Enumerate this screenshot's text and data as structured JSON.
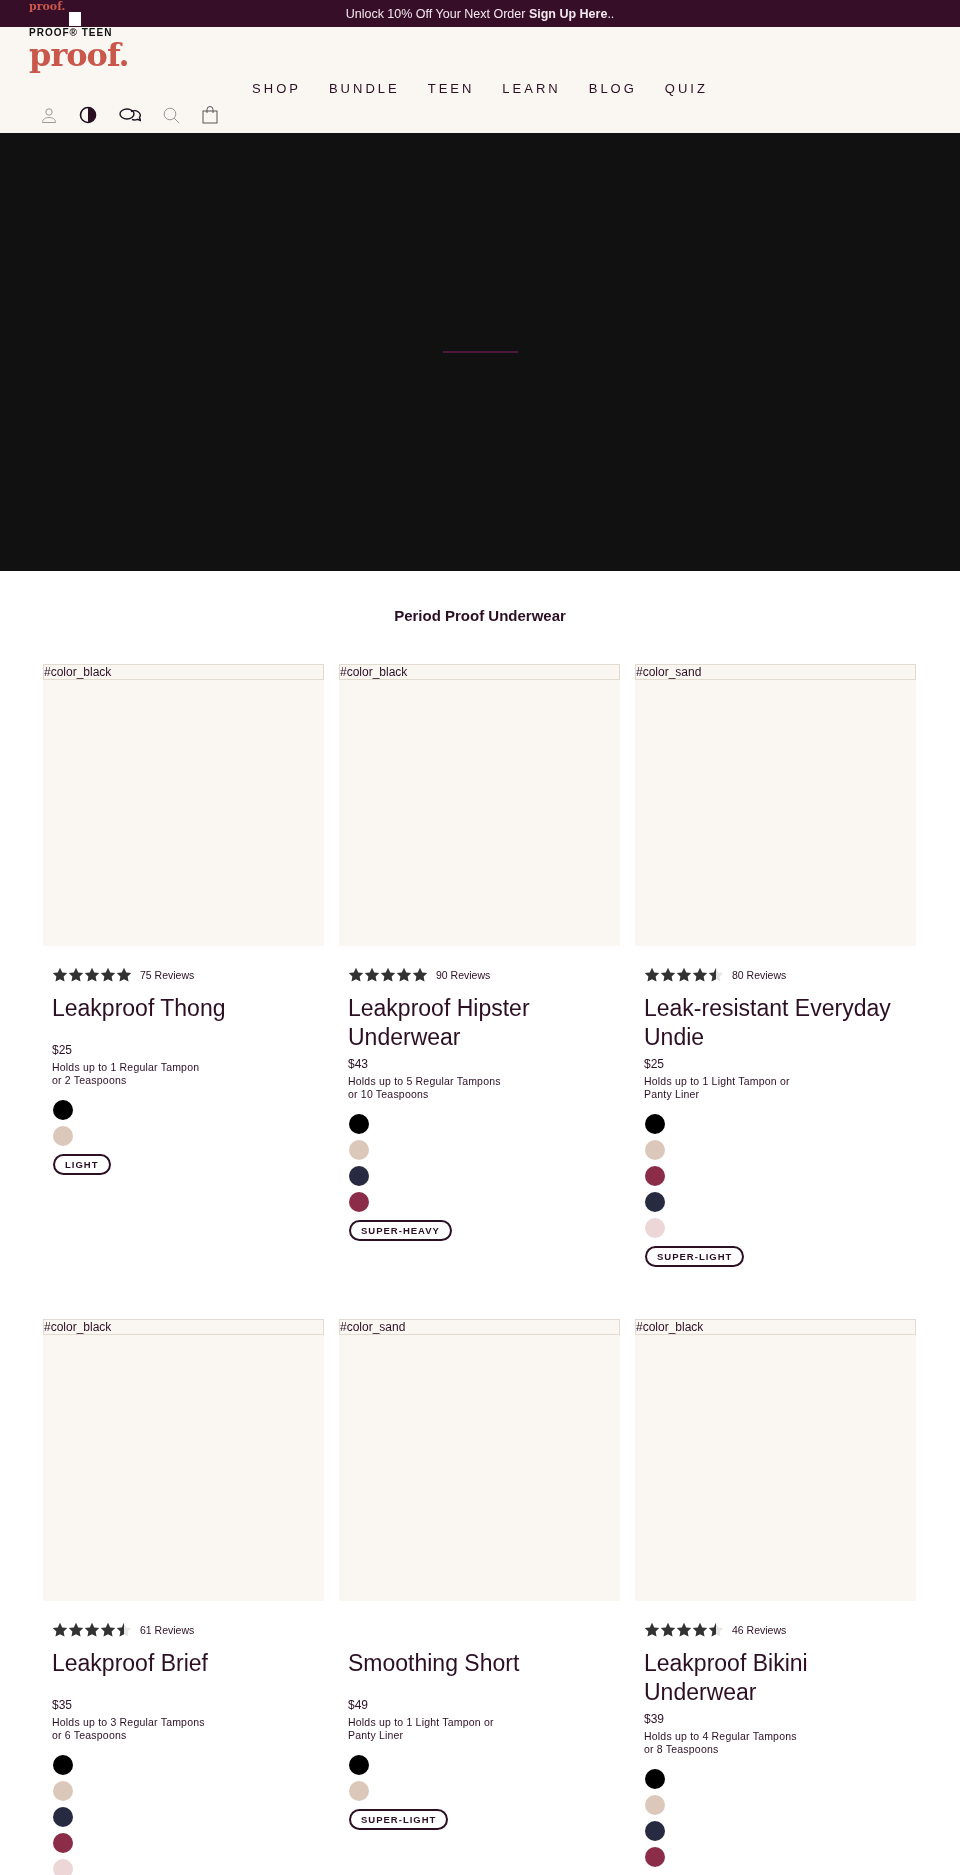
{
  "announcement": {
    "text": "Unlock 10% Off Your Next Order **Sign Up Here**.."
  },
  "logo": {
    "small": "proof.",
    "line": "PROOF® TEEN",
    "big": "proof."
  },
  "nav": [
    "SHOP",
    "BUNDLE",
    "TEEN",
    "LEARN",
    "BLOG",
    "QUIZ"
  ],
  "section_title": "Period Proof Underwear",
  "products": [
    {
      "image_alt": "#color_black",
      "stars": 5,
      "reviews": "75 Reviews",
      "name": "Leakproof Thong",
      "price": "$25",
      "description": "Holds up to 1 Regular Tampon\nor 2 Teaspoons",
      "swatches": [
        {
          "color": "#000000"
        },
        {
          "color": "#dcc8ba"
        }
      ],
      "badge": "LIGHT"
    },
    {
      "image_alt": "#color_black",
      "stars": 5,
      "reviews": "90 Reviews",
      "name": "Leakproof Hipster Underwear",
      "price": "$43",
      "description": "Holds up to 5 Regular Tampons\nor 10 Teaspoons",
      "swatches": [
        {
          "color": "#000000"
        },
        {
          "color": "#dcc8ba"
        },
        {
          "color": "#272a40"
        },
        {
          "color": "#8b2c48"
        }
      ],
      "badge": "SUPER-HEAVY"
    },
    {
      "image_alt": "#color_sand",
      "stars": 4.5,
      "reviews": "80 Reviews",
      "name": "Leak-resistant Everyday Undie",
      "price": "$25",
      "description": "Holds up to 1 Light Tampon or\nPanty Liner",
      "swatches": [
        {
          "color": "#000000"
        },
        {
          "color": "#dcc8ba"
        },
        {
          "color": "#8b2c48"
        },
        {
          "color": "#272a40"
        },
        {
          "color": "#ecd6d8"
        }
      ],
      "badge": "SUPER-LIGHT"
    },
    {
      "image_alt": "#color_black",
      "stars": 4.5,
      "reviews": "61 Reviews",
      "name": "Leakproof Brief",
      "price": "$35",
      "description": "Holds up to 3 Regular Tampons\nor 6 Teaspoons",
      "swatches": [
        {
          "color": "#000000"
        },
        {
          "color": "#dcc8ba"
        },
        {
          "color": "#272a40"
        },
        {
          "color": "#8b2c48"
        },
        {
          "color": "#ecd6d8"
        }
      ]
    },
    {
      "image_alt": "#color_sand",
      "name": "Smoothing Short",
      "price": "$49",
      "description": "Holds up to 1 Light Tampon or\nPanty Liner",
      "swatches": [
        {
          "color": "#000000"
        },
        {
          "color": "#dcc8ba"
        }
      ],
      "badge": "SUPER-LIGHT"
    },
    {
      "image_alt": "#color_black",
      "stars": 4.5,
      "reviews": "46 Reviews",
      "name": "Leakproof Bikini Underwear",
      "price": "$39",
      "description": "Holds up to 4 Regular Tampons\nor 8 Teaspoons",
      "swatches": [
        {
          "color": "#000000"
        },
        {
          "color": "#dcc8ba"
        },
        {
          "color": "#272a40"
        },
        {
          "color": "#8b2c48"
        }
      ]
    }
  ]
}
